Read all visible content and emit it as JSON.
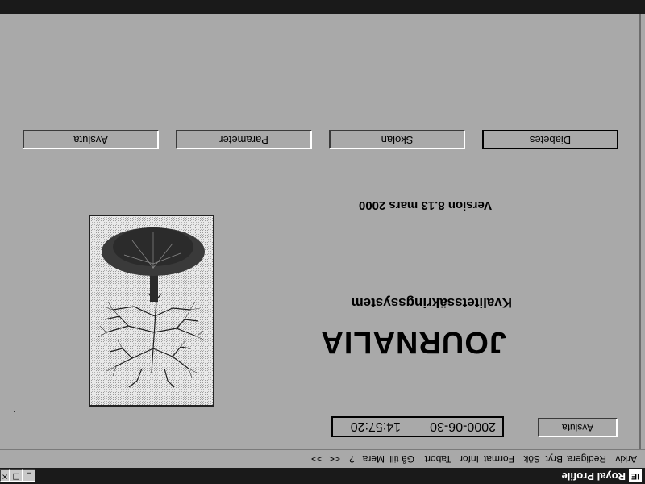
{
  "window": {
    "title": "Royal Profile",
    "icon_glyph": "IE",
    "controls": {
      "minimize": "_",
      "maximize": "□",
      "close": "×"
    }
  },
  "menu": {
    "items": [
      "Arkiv",
      "Redigera",
      "Bryt",
      "Sök",
      "Format",
      "Infor",
      "Tabort",
      "Gå till",
      "Mera",
      "?",
      "<<",
      ">>"
    ]
  },
  "form": {
    "nav_buttons": [
      "Diabetes",
      "Skolan",
      "Parameter",
      "Avsluta"
    ],
    "version": "Version 8.13 mars 2000",
    "product_title": "JOURNALIA",
    "product_subtitle": "Kvalitetssäkringssystem",
    "date": "2000-06-30",
    "time": "14:57:20",
    "exit_button": "Avsluta",
    "logo": "tree-with-roots-image"
  },
  "colors": {
    "background": "#a9a9a9",
    "titlebar": "#1a1a1a",
    "button_face": "#a9a9a9",
    "logo_background": "#e6e6e6"
  },
  "orientation": "rotated 180 degrees"
}
